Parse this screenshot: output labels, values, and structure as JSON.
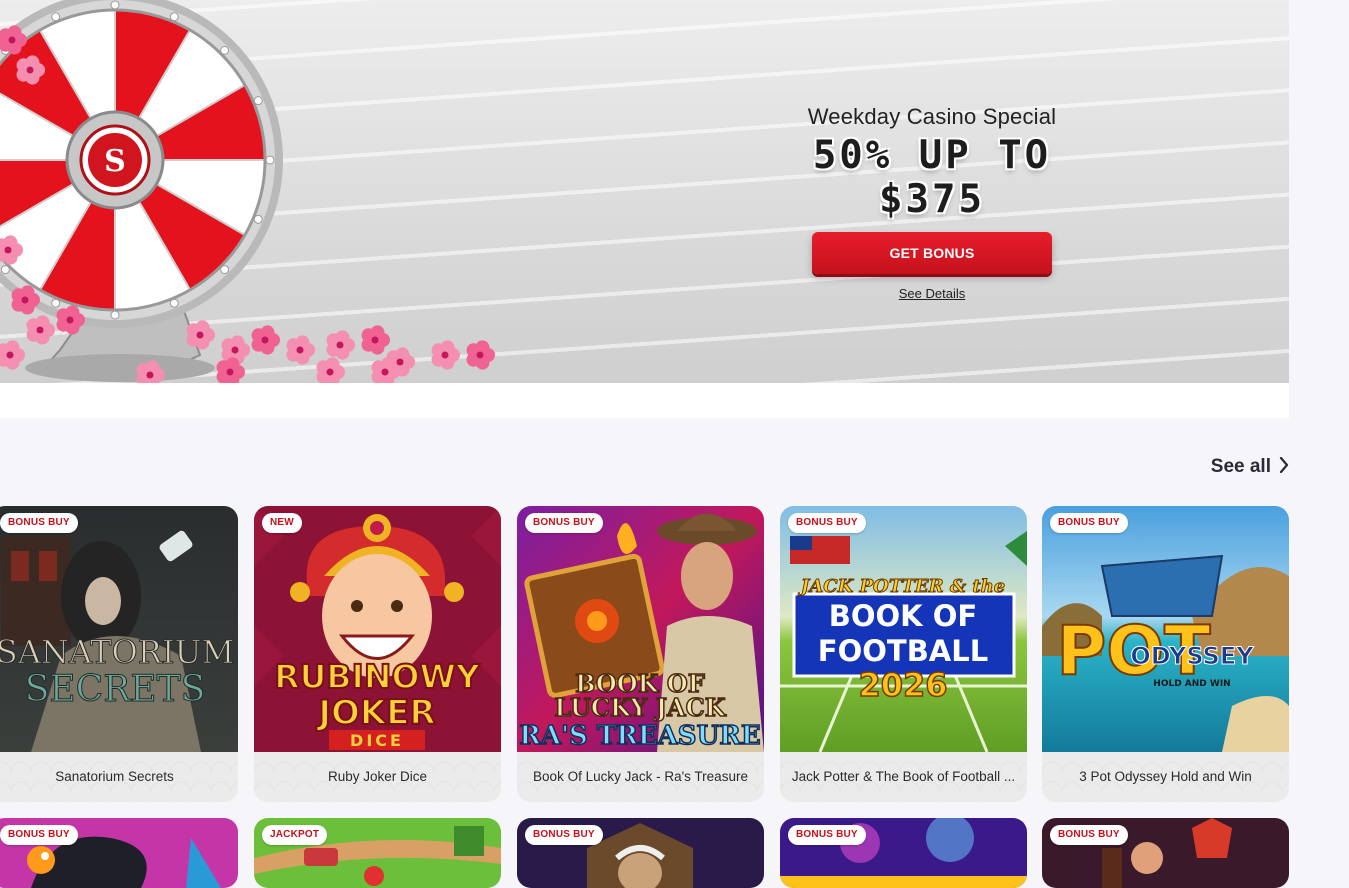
{
  "banner": {
    "subtitle": "Weekday Casino Special",
    "title": "50% UP TO $375",
    "cta_label": "GET BONUS",
    "details_link": "See Details",
    "wheel_logo_letter": "S"
  },
  "section": {
    "see_all_label": "See all",
    "see_all_icon": "chevron-right-icon"
  },
  "colors": {
    "accent": "#d1151f",
    "badge_text": "#c8101c",
    "page_bg": "#f6f5fa"
  },
  "games_row1": [
    {
      "badge": "BONUS BUY",
      "name": "Sanatorium Secrets",
      "art_title": [
        "SANATORIUM",
        "SECRETS"
      ]
    },
    {
      "badge": "NEW",
      "name": "Ruby Joker Dice",
      "art_title": [
        "RUBINOWY",
        "JOKER",
        "DICE"
      ]
    },
    {
      "badge": "BONUS BUY",
      "name": "Book Of Lucky Jack - Ra's Treasure",
      "art_title": [
        "BOOK OF",
        "LUCKY JACK",
        "RA'S TREASURE"
      ]
    },
    {
      "badge": "BONUS BUY",
      "name": "Jack Potter & The Book of Football ...",
      "art_title": [
        "JACK POTTER & the",
        "BOOK OF",
        "FOOTBALL",
        "2026"
      ]
    },
    {
      "badge": "BONUS BUY",
      "name": "3 Pot Odyssey Hold and Win",
      "art_title": [
        "3 POT",
        "ODYSSEY",
        "HOLD AND WIN"
      ]
    }
  ],
  "games_row2": [
    {
      "badge": "BONUS BUY"
    },
    {
      "badge": "JACKPOT"
    },
    {
      "badge": "BONUS BUY"
    },
    {
      "badge": "BONUS BUY"
    },
    {
      "badge": "BONUS BUY"
    }
  ]
}
